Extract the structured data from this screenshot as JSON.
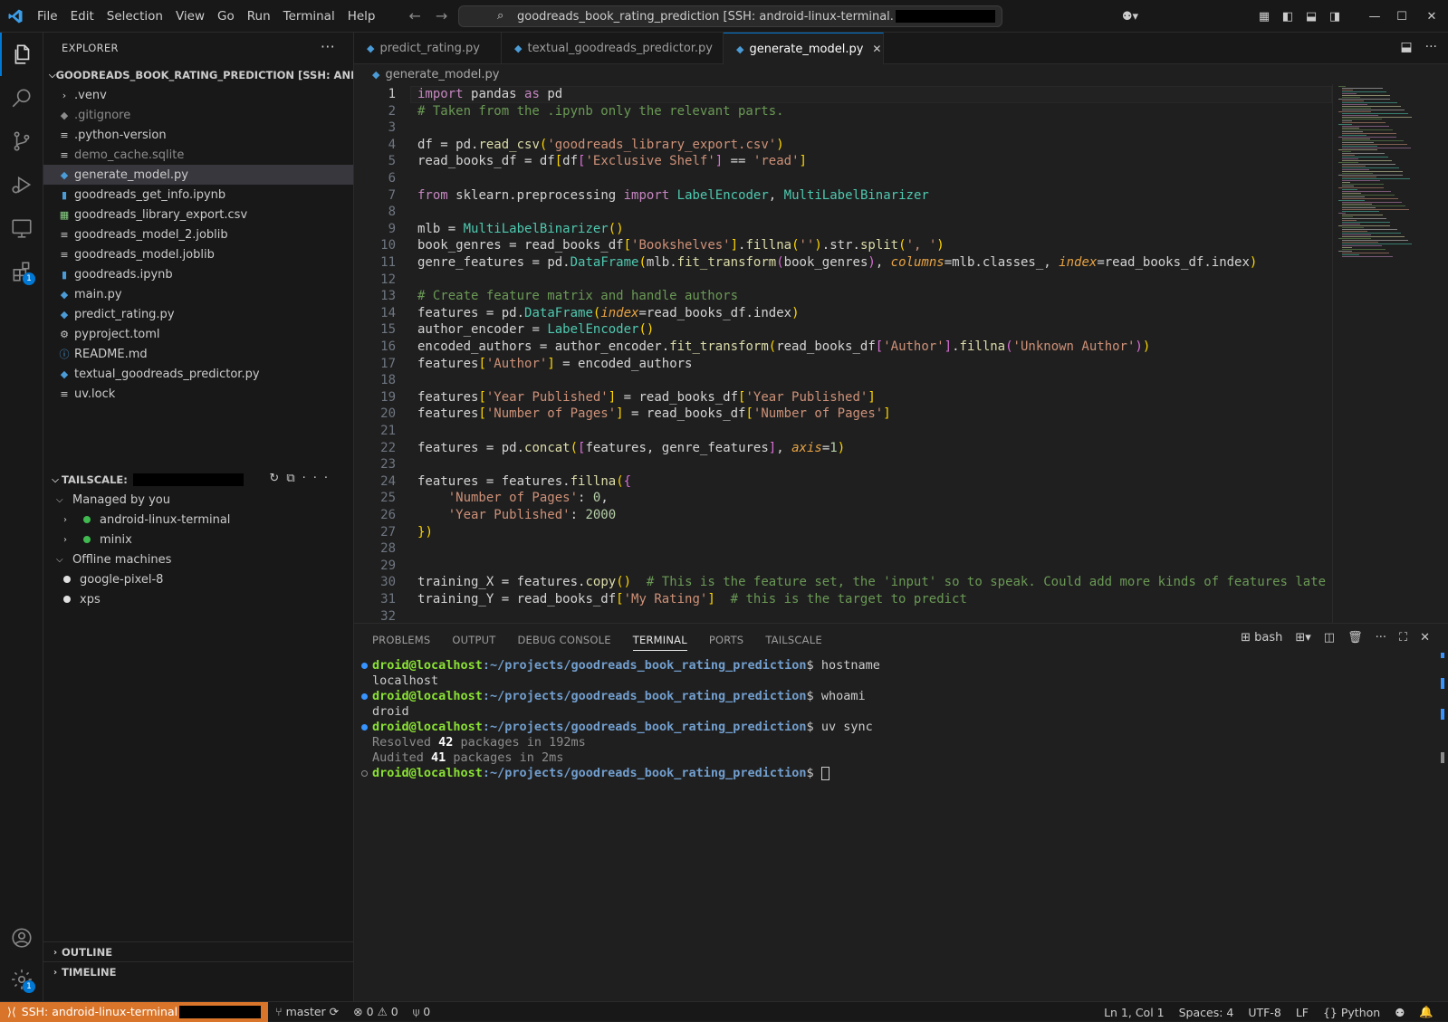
{
  "menu": [
    "File",
    "Edit",
    "Selection",
    "View",
    "Go",
    "Run",
    "Terminal",
    "Help"
  ],
  "command_center": "goodreads_book_rating_prediction [SSH: android-linux-terminal.",
  "explorer": {
    "header": "EXPLORER",
    "root": "GOODREADS_BOOK_RATING_PREDICTION [SSH: ANDROID...",
    "files": [
      {
        "name": ".venv",
        "type": "folder"
      },
      {
        "name": ".gitignore",
        "type": "git"
      },
      {
        "name": ".python-version",
        "type": "text"
      },
      {
        "name": "demo_cache.sqlite",
        "type": "text"
      },
      {
        "name": "generate_model.py",
        "type": "python"
      },
      {
        "name": "goodreads_get_info.ipynb",
        "type": "notebook"
      },
      {
        "name": "goodreads_library_export.csv",
        "type": "csv"
      },
      {
        "name": "goodreads_model_2.joblib",
        "type": "text"
      },
      {
        "name": "goodreads_model.joblib",
        "type": "text"
      },
      {
        "name": "goodreads.ipynb",
        "type": "notebook"
      },
      {
        "name": "main.py",
        "type": "python"
      },
      {
        "name": "predict_rating.py",
        "type": "python"
      },
      {
        "name": "pyproject.toml",
        "type": "gear"
      },
      {
        "name": "README.md",
        "type": "info"
      },
      {
        "name": "textual_goodreads_predictor.py",
        "type": "python"
      },
      {
        "name": "uv.lock",
        "type": "text"
      }
    ]
  },
  "tailscale": {
    "title": "TAILSCALE:",
    "managed_label": "Managed by you",
    "managed": [
      "android-linux-terminal",
      "minix"
    ],
    "offline_label": "Offline machines",
    "offline": [
      "google-pixel-8",
      "xps"
    ]
  },
  "outline_label": "OUTLINE",
  "timeline_label": "TIMELINE",
  "tabs": [
    "predict_rating.py",
    "textual_goodreads_predictor.py",
    "generate_model.py"
  ],
  "breadcrumb": "generate_model.py",
  "code_lines": [
    "import pandas as pd",
    "# Taken from the .ipynb only the relevant parts.",
    "",
    "df = pd.read_csv('goodreads_library_export.csv')",
    "read_books_df = df[df['Exclusive Shelf'] == 'read']",
    "",
    "from sklearn.preprocessing import LabelEncoder, MultiLabelBinarizer",
    "",
    "mlb = MultiLabelBinarizer()",
    "book_genres = read_books_df['Bookshelves'].fillna('').str.split(', ')",
    "genre_features = pd.DataFrame(mlb.fit_transform(book_genres), columns=mlb.classes_, index=read_books_df.index)",
    "",
    "# Create feature matrix and handle authors",
    "features = pd.DataFrame(index=read_books_df.index)",
    "author_encoder = LabelEncoder()",
    "encoded_authors = author_encoder.fit_transform(read_books_df['Author'].fillna('Unknown Author'))",
    "features['Author'] = encoded_authors",
    "",
    "features['Year Published'] = read_books_df['Year Published']",
    "features['Number of Pages'] = read_books_df['Number of Pages']",
    "",
    "features = pd.concat([features, genre_features], axis=1)",
    "",
    "features = features.fillna({",
    "    'Number of Pages': 0,",
    "    'Year Published': 2000",
    "})",
    "",
    "",
    "training_X = features.copy()  # This is the feature set, the 'input' so to speak. Could add more kinds of features late",
    "training_Y = read_books_df['My Rating']  # this is the target to predict"
  ],
  "panel_tabs": [
    "PROBLEMS",
    "OUTPUT",
    "DEBUG CONSOLE",
    "TERMINAL",
    "PORTS",
    "TAILSCALE"
  ],
  "terminal_shell": "bash",
  "terminal": {
    "prompt_user": "droid@localhost",
    "prompt_path": ":~/projects/goodreads_book_rating_prediction",
    "cmd1": "hostname",
    "out1": "localhost",
    "cmd2": "whoami",
    "out2": "droid",
    "cmd3": "uv sync",
    "out3a_pre": "Resolved ",
    "out3a_num": "42",
    "out3a_post": " packages in 192ms",
    "out3b_pre": "Audited ",
    "out3b_num": "41",
    "out3b_post": " packages in 2ms"
  },
  "status": {
    "remote": "SSH: android-linux-terminal",
    "branch": "master",
    "errors": "0",
    "warnings": "0",
    "ports": "0",
    "position": "Ln 1, Col 1",
    "spaces": "Spaces: 4",
    "encoding": "UTF-8",
    "eol": "LF",
    "language": "Python"
  },
  "badges": {
    "extensions": "1",
    "settings": "1"
  },
  "colors": {
    "accent": "#0078d4",
    "remote": "#d9752a",
    "online": "#3fb950"
  }
}
